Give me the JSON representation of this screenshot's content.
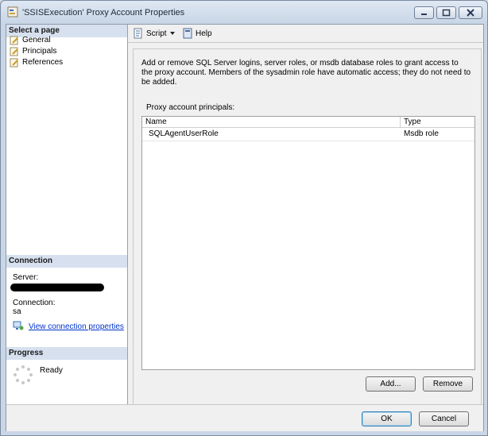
{
  "window": {
    "title": "'SSISExecution' Proxy Account Properties"
  },
  "left_panel": {
    "select_page_header": "Select a page",
    "pages": [
      {
        "label": "General",
        "icon": "page-wrench-icon"
      },
      {
        "label": "Principals",
        "icon": "page-wrench-icon"
      },
      {
        "label": "References",
        "icon": "page-wrench-icon"
      }
    ],
    "connection_header": "Connection",
    "server_label": "Server:",
    "server_value_redacted": true,
    "connection_label": "Connection:",
    "connection_value": "sa",
    "view_connection_link": "View connection properties",
    "progress_header": "Progress",
    "progress_status": "Ready"
  },
  "toolbar": {
    "script_label": "Script",
    "help_label": "Help"
  },
  "main": {
    "description": "Add or remove SQL Server logins, server roles, or msdb database roles to grant access to the proxy account. Members of the sysadmin role have automatic access; they do not need to be added.",
    "principals_label": "Proxy account principals:",
    "columns": [
      "Name",
      "Type"
    ],
    "rows": [
      {
        "name": "SQLAgentUserRole",
        "type": "Msdb role"
      }
    ],
    "add_label": "Add...",
    "remove_label": "Remove"
  },
  "footer": {
    "ok_label": "OK",
    "cancel_label": "Cancel"
  }
}
